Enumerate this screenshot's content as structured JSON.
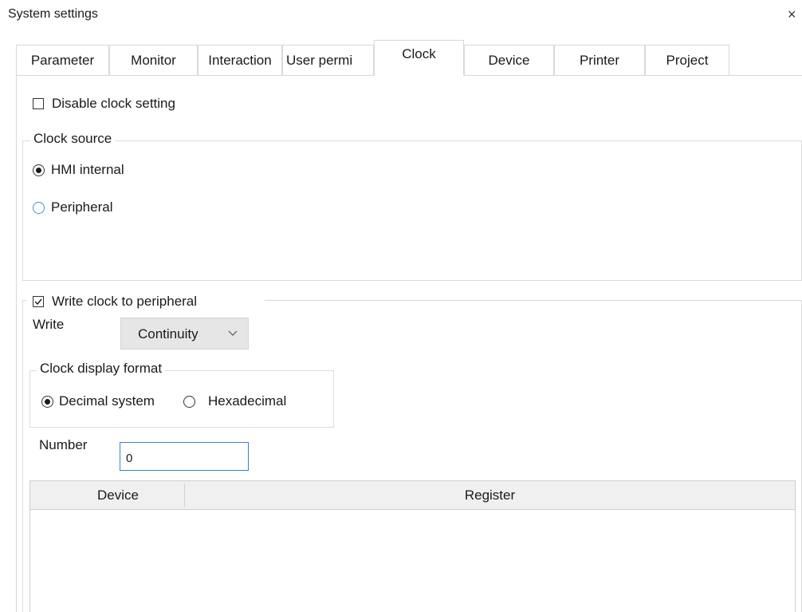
{
  "window": {
    "title": "System settings",
    "close_glyph": "×"
  },
  "tabs": [
    {
      "label": "Parameter"
    },
    {
      "label": "Monitor"
    },
    {
      "label": "Interaction"
    },
    {
      "label": "User permi"
    },
    {
      "label": "Clock",
      "active": true
    },
    {
      "label": "Device"
    },
    {
      "label": "Printer"
    },
    {
      "label": "Project"
    }
  ],
  "clock": {
    "disable_clock_setting": {
      "label": "Disable clock setting",
      "checked": false
    },
    "clock_source": {
      "legend": "Clock source",
      "options": [
        {
          "label": "HMI internal",
          "selected": true
        },
        {
          "label": "Peripheral",
          "selected": false
        }
      ]
    },
    "write_clock": {
      "label": "Write clock to peripheral",
      "checked": true,
      "write_label": "Write",
      "write_mode": {
        "value": "Continuity",
        "icon": "chevron-down-icon"
      },
      "display_format": {
        "legend": "Clock display format",
        "options": [
          {
            "label": "Decimal system",
            "selected": true
          },
          {
            "label": "Hexadecimal",
            "selected": false
          }
        ]
      },
      "number_label": "Number",
      "number_value": "0",
      "table": {
        "columns": [
          "Device",
          "Register"
        ],
        "rows": []
      }
    }
  },
  "colors": {
    "accent": "#3f7fce",
    "radio_unselected_blue": "#4f8fd0",
    "tab_border": "#d9d9d9"
  }
}
